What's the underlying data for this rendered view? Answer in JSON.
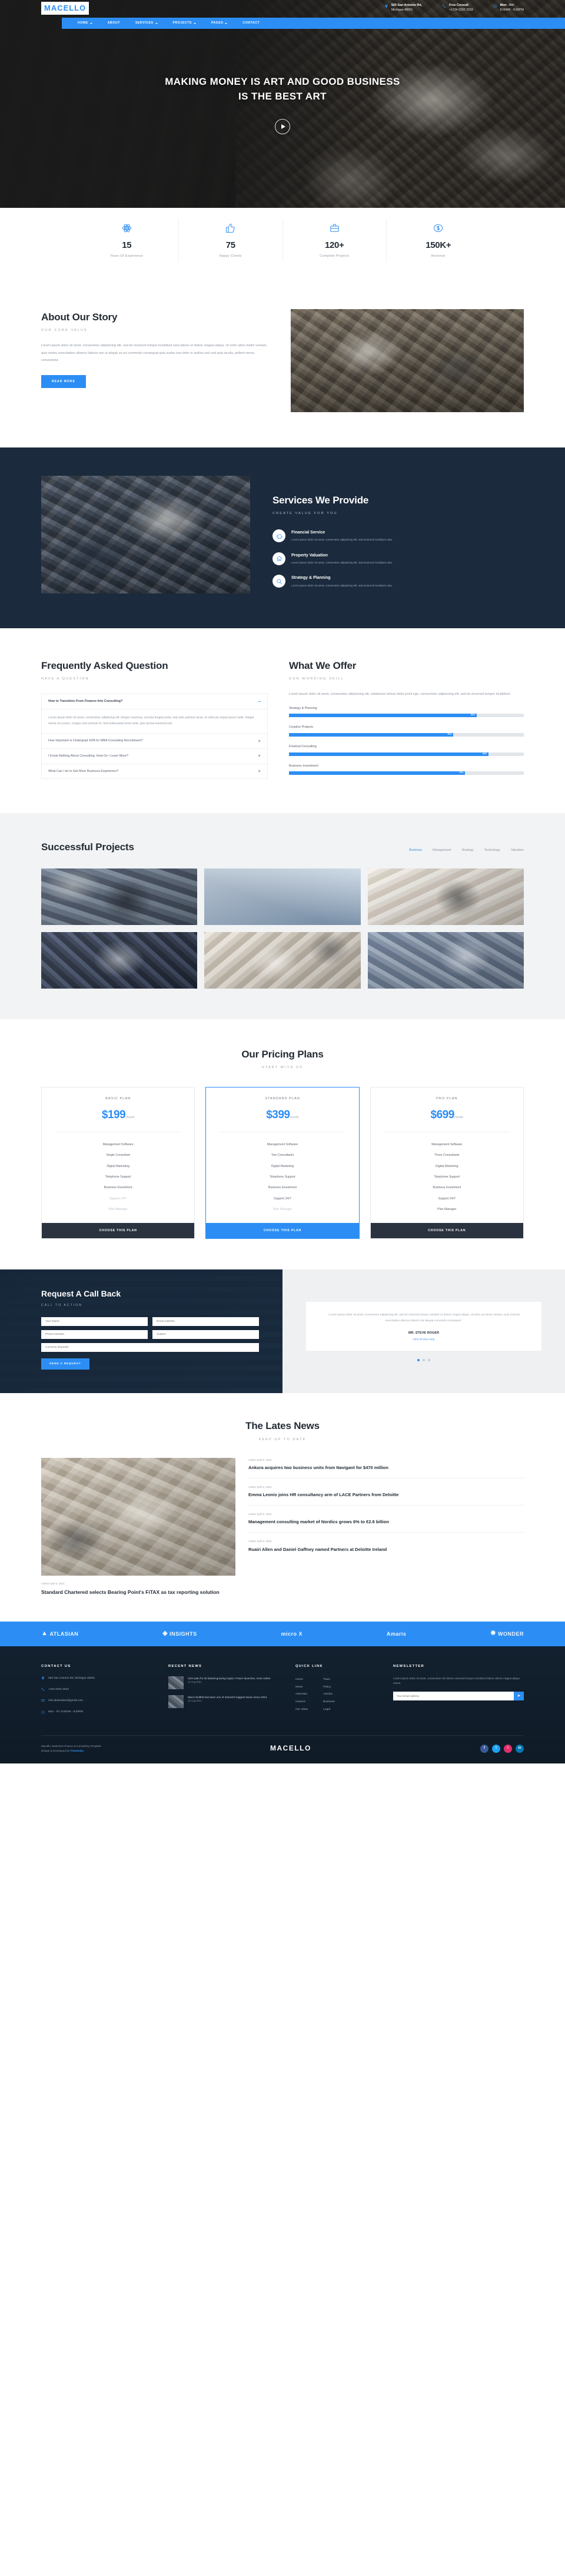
{
  "brand": {
    "name": "MACELLO"
  },
  "topbar": {
    "contacts": [
      {
        "icon": "map-pin-icon",
        "line1": "920 San Antonio Rd,",
        "line2": "Michigan 48001"
      },
      {
        "icon": "phone-icon",
        "line1": "Free Consult",
        "line2": "+1234 0202 3333"
      },
      {
        "icon": "clock-icon",
        "line1": "Mon - Fri:",
        "line2": "8:00AM - 6:00PM"
      }
    ]
  },
  "nav": {
    "items": [
      {
        "label": "HOME",
        "has_dropdown": true
      },
      {
        "label": "ABOUT",
        "has_dropdown": false
      },
      {
        "label": "SERVICES",
        "has_dropdown": true
      },
      {
        "label": "PROJECTS",
        "has_dropdown": true
      },
      {
        "label": "PAGES",
        "has_dropdown": true
      },
      {
        "label": "CONTACT",
        "has_dropdown": false
      }
    ]
  },
  "hero": {
    "line1": "MAKING MONEY IS ART AND GOOD BUSINESS",
    "line2": "IS THE BEST ART",
    "play_icon": "play-icon"
  },
  "counters": [
    {
      "icon": "atom-icon",
      "value": "15",
      "label": "Years Of Experience"
    },
    {
      "icon": "thumbs-up-icon",
      "value": "75",
      "label": "Happy Clients"
    },
    {
      "icon": "briefcase-icon",
      "value": "120+",
      "label": "Complete Projects"
    },
    {
      "icon": "dollar-icon",
      "value": "150K+",
      "label": "Revenue"
    }
  ],
  "about": {
    "title": "About Our Story",
    "subtitle": "OUR CORE VALUE",
    "paragraph": "Lorem ipsum dolor sit amet, consectetur adipisicing elit, sed do eiusmod tempor incididunt utsa labore et dolore magna aliqua. Ut enim ados minim veniam, quis nostru exercitation ullamco laboris nisi ut aliquip ex ea commodo consequat quis audes sea dolor in quilina sed sed quia iaculis, pellent sierra, consectetur.",
    "button": "READ MORE"
  },
  "services": {
    "title": "Services We Provide",
    "subtitle": "CREATE VALUE FOR YOU",
    "items": [
      {
        "icon": "piggy-bank-icon",
        "name": "Financial Service",
        "desc": "Lorem ipsum dolor sit amet, consectetur adipisicing elit, sed eiusmod incididunt utsa"
      },
      {
        "icon": "home-icon",
        "name": "Property Valuation",
        "desc": "Lorem ipsum dolor sit amet, consectetur adipisicing elit, sed eiusmod incididunt utsa"
      },
      {
        "icon": "search-icon",
        "name": "Strategy & Planning",
        "desc": "Lorem ipsum dolor sit amet, consectetur adipisicing elit, sed eiusmod incididunt utsa"
      }
    ]
  },
  "faq": {
    "title": "Frequently Asked Question",
    "subtitle": "HAVE A QUESTION",
    "items": [
      {
        "q": "How to Transition From Finance Into Consulting?",
        "open": true,
        "a": "Lorem ipsum dolor sit amet, consectetur adipiscing elit. Integer maximus, arcesta feugiat porta, erat ante pulvinar lacus, et vehicula neque ipsum nulla. Integer vivera orci purus, congue sem pretium et. Sed malesuada lorem ante, quis lacinia euismod sed"
      },
      {
        "q": "How Important is Undergrad GPA for MBA Consulting Recruitment?",
        "open": false,
        "a": ""
      },
      {
        "q": "I Know Nothing About Consulting. How Do I Learn More?",
        "open": false,
        "a": ""
      },
      {
        "q": "What Can I do to Get More Business Experience?",
        "open": false,
        "a": ""
      }
    ]
  },
  "skills": {
    "title": "What We Offer",
    "subtitle": "OUR WORKING SKILL",
    "paragraph": "Lorem ipsum dolor sit amet, consectetur adipisicing elit, saladones tehran dolor jenni ego, consectetur adipisicing elit, sed do eiusmod tempor incididunt.",
    "bars": [
      {
        "name": "Strategy & Planning",
        "pct": 80,
        "label": "80%"
      },
      {
        "name": "Creative Projects",
        "pct": 70,
        "label": "70%"
      },
      {
        "name": "Finalcial Consulting",
        "pct": 85,
        "label": "85%"
      },
      {
        "name": "Business Investment",
        "pct": 75,
        "label": "75%"
      }
    ]
  },
  "projects": {
    "title": "Successful Projects",
    "filters": [
      {
        "label": "Business",
        "active": true
      },
      {
        "label": "Management",
        "active": false
      },
      {
        "label": "Strategy",
        "active": false
      },
      {
        "label": "Technology",
        "active": false
      },
      {
        "label": "Valuation",
        "active": false
      }
    ],
    "cells": [
      "p1",
      "p2",
      "p3",
      "p4",
      "p5",
      "p6"
    ]
  },
  "pricing": {
    "title": "Our Pricing Plans",
    "subtitle": "START WITH US",
    "plans": [
      {
        "name": "BASIC PLAN",
        "price": "$199",
        "per": "/month",
        "featured": false,
        "features": [
          {
            "text": "Management Software",
            "enabled": true
          },
          {
            "text": "Single Consultant",
            "enabled": true
          },
          {
            "text": "Digital Marketing",
            "enabled": true
          },
          {
            "text": "Telephone Support",
            "enabled": true
          },
          {
            "text": "Business Investment",
            "enabled": true
          },
          {
            "text": "Support 24/7",
            "enabled": false
          },
          {
            "text": "Plan Manager",
            "enabled": false
          }
        ],
        "cta": "CHOOSE THIS PLAN"
      },
      {
        "name": "STANDARD PLAN",
        "price": "$399",
        "per": "/month",
        "featured": true,
        "features": [
          {
            "text": "Management Software",
            "enabled": true
          },
          {
            "text": "Two Consultants",
            "enabled": true
          },
          {
            "text": "Digital Marketing",
            "enabled": true
          },
          {
            "text": "Telephone Support",
            "enabled": true
          },
          {
            "text": "Business Investment",
            "enabled": true
          },
          {
            "text": "Support 24/7",
            "enabled": true
          },
          {
            "text": "Plan Manager",
            "enabled": false
          }
        ],
        "cta": "CHOOSE THIS PLAN"
      },
      {
        "name": "PRO PLAN",
        "price": "$699",
        "per": "/month",
        "featured": false,
        "features": [
          {
            "text": "Management Software",
            "enabled": true
          },
          {
            "text": "Three Consultants",
            "enabled": true
          },
          {
            "text": "Digital Marketing",
            "enabled": true
          },
          {
            "text": "Telephone Support",
            "enabled": true
          },
          {
            "text": "Business Investment",
            "enabled": true
          },
          {
            "text": "Support 24/7",
            "enabled": true
          },
          {
            "text": "Plan Manager",
            "enabled": true
          }
        ],
        "cta": "CHOOSE THIS PLAN"
      }
    ]
  },
  "callback": {
    "title": "Request A Call Back",
    "subtitle": "CALL TO ACTION",
    "fields": [
      {
        "name": "name-field",
        "placeholder": "Your Name"
      },
      {
        "name": "email-field",
        "placeholder": "Email Address"
      },
      {
        "name": "phone-field",
        "placeholder": "Phone Number"
      },
      {
        "name": "subject-field",
        "placeholder": "Subject"
      },
      {
        "name": "enquiry-field",
        "placeholder": "Currency Deposits"
      }
    ],
    "submit": "SEND A REQUEST",
    "testimonial": {
      "text": "\"Lorem ipsum dolor sit amet, consectetur adipisicing elit, sed do eiusmod tempor utsolare et dolore magna aliqua. Ut enim ad minim veniam, quis nostrud exercitation ullamco laboris nisi aliquip commodo consequat.\"",
      "name": "MR. STEVE ROGER",
      "role": "CEO of USA Corp"
    },
    "dots": [
      true,
      false,
      false
    ]
  },
  "news": {
    "title": "The Lates News",
    "subtitle": "KEEP UP TO DATE",
    "featured": {
      "meta": "Admin  April 6, 2021",
      "headline": "Standard Chartered selects Bearing Point's FiTAX as tax reporting solution"
    },
    "items": [
      {
        "meta": "Admin  April 6, 2021",
        "headline": "Ankura acquires two business units from Navigant for $470 million"
      },
      {
        "meta": "Admin  April 6, 2021",
        "headline": "Emma Leonis joins HR consultancy arm of LACE Partners from Deloitte"
      },
      {
        "meta": "Admin  April 6, 2021",
        "headline": "Management consulting market of Nordics grows 6% to €2.8 billion"
      },
      {
        "meta": "Admin  April 6, 2021",
        "headline": "Ruairi Allen and Daniel Gaffney named Partners at Deloitte Ireland"
      }
    ]
  },
  "logos": [
    {
      "name": "ATLASIAN"
    },
    {
      "name": "INSIGHTS"
    },
    {
      "name": "micro X"
    },
    {
      "name": "Amaris"
    },
    {
      "name": "WONDER"
    }
  ],
  "footer": {
    "contact": {
      "title": "CONTACT US",
      "items": [
        {
          "icon": "map-pin-icon",
          "text": "920 San Antonio Rd, Michigan 48001"
        },
        {
          "icon": "phone-icon",
          "text": "+234 0202 3333"
        },
        {
          "icon": "mail-icon",
          "text": "info.destination@gmail.com"
        },
        {
          "icon": "clock-icon",
          "text": "Mon - Fri: 8:00AM - 6:00PM"
        }
      ]
    },
    "recent_news": {
      "title": "RECENT NEWS",
      "items": [
        {
          "date": "12 Aug 2021",
          "text": "Citi's plan for its fastest-growing region: Power launches, more online"
        },
        {
          "date": "12 Aug 2021",
          "text": "Macro Buffett has been one of interest's biggest haven since 2013"
        }
      ]
    },
    "quick_link": {
      "title": "QUICK LINK",
      "col1": [
        "Home",
        "News",
        "Advertise",
        "Careers",
        "Our Value"
      ],
      "col2": [
        "Team",
        "Policy",
        "Articles",
        "Business",
        "Legal"
      ]
    },
    "newsletter": {
      "title": "NEWSLETTER",
      "desc": "Lorem ipsum dolor sit amet, consectetur elit dolore eiusmod tempor incididunt labore dolore magna aliqua enims.",
      "placeholder": "Your Email Address",
      "button_icon": "send-icon"
    },
    "copyright_prefix": "Macello. Business Finance & Consulting Template",
    "copyright_suffix": "Design & Developed by ",
    "copyright_author": "ThemeSky",
    "logo": "MACELLO",
    "social": [
      "f",
      "t",
      "i",
      "in"
    ]
  }
}
